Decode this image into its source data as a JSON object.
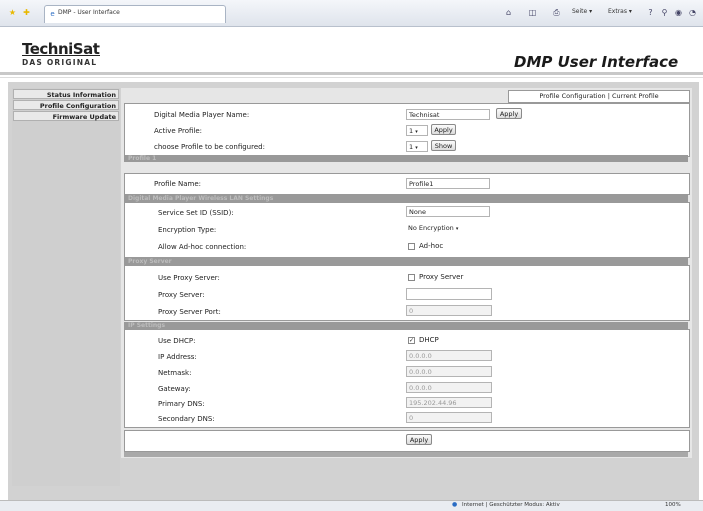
{
  "browser": {
    "tab_title": "DMP - User Interface",
    "toolbar": {
      "page": "Seite ▾",
      "extras": "Extras ▾"
    },
    "status_zone": "Internet | Geschützter Modus: Aktiv",
    "zoom": "100%"
  },
  "header": {
    "logo_top": "TechniSat",
    "logo_bottom": "DAS ORIGINAL",
    "title": "DMP User Interface"
  },
  "sidebar": {
    "items": [
      {
        "label": "Status Information"
      },
      {
        "label": "Profile Configuration"
      },
      {
        "label": "Firmware Update"
      }
    ]
  },
  "breadcrumb": "Profile Configuration | Current Profile",
  "top": {
    "player_name_label": "Digital Media Player Name:",
    "player_name_value": "Technisat",
    "apply": "Apply",
    "active_profile_label": "Active Profile:",
    "active_profile_value": "1",
    "choose_label": "choose Profile to be configured:",
    "choose_value": "1",
    "show": "Show"
  },
  "profile": {
    "section": "Profile 1",
    "name_label": "Profile Name:",
    "name_value": "Profile1"
  },
  "wlan": {
    "section": "Digital Media Player Wireless LAN Settings",
    "ssid_label": "Service Set ID (SSID):",
    "ssid_value": "None",
    "enc_label": "Encryption Type:",
    "enc_value": "No Encryption",
    "adhoc_label": "Allow Ad-hoc connection:",
    "adhoc_cb": "Ad-hoc"
  },
  "proxy": {
    "section": "Proxy Server",
    "use_label": "Use Proxy Server:",
    "use_cb": "Proxy Server",
    "server_label": "Proxy Server:",
    "server_value": "",
    "port_label": "Proxy Server Port:",
    "port_value": "0"
  },
  "ip": {
    "section": "IP Settings",
    "dhcp_label": "Use DHCP:",
    "dhcp_cb": "DHCP",
    "ip_label": "IP Address:",
    "ip_value": "0.0.0.0",
    "mask_label": "Netmask:",
    "mask_value": "0.0.0.0",
    "gw_label": "Gateway:",
    "gw_value": "0.0.0.0",
    "dns1_label": "Primary DNS:",
    "dns1_value": "195.202.44.96",
    "dns2_label": "Secondary DNS:",
    "dns2_value": "0"
  },
  "footer": {
    "apply": "Apply"
  }
}
